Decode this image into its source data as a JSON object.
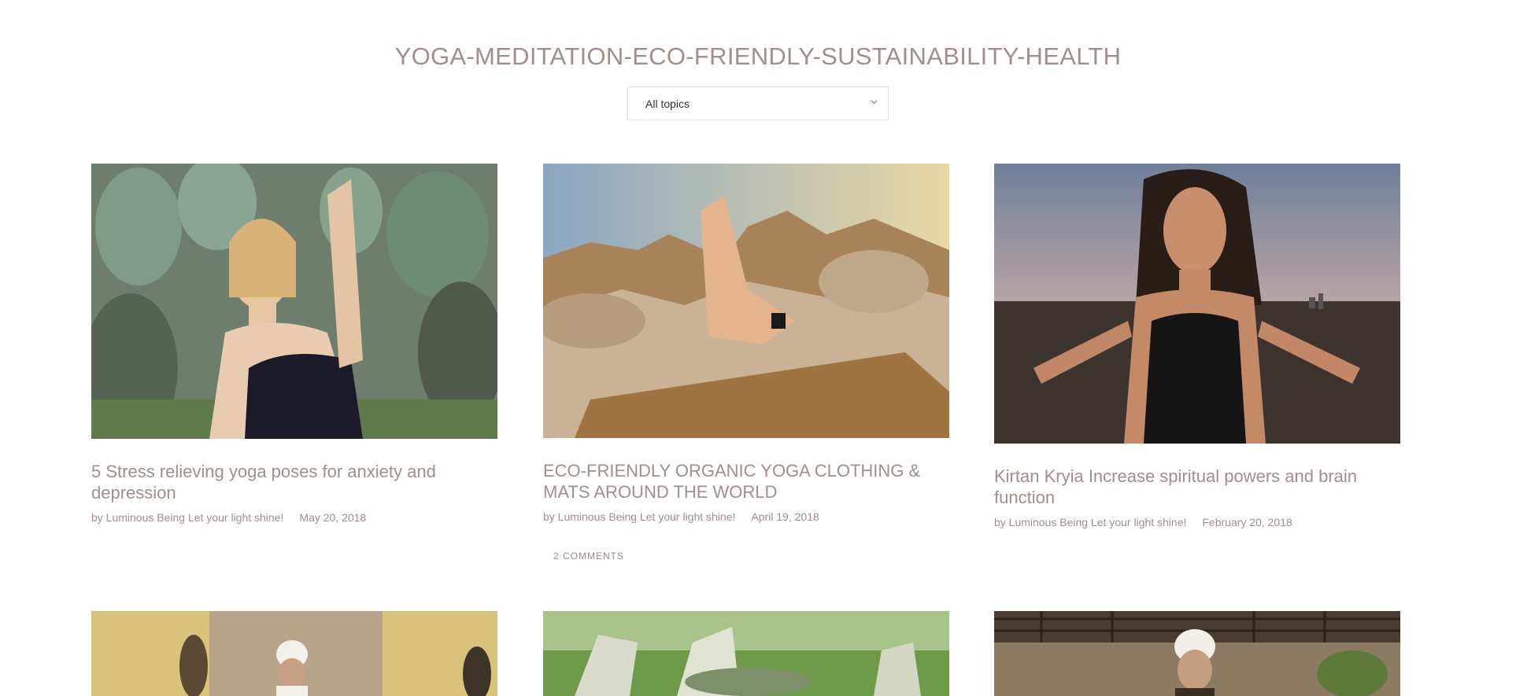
{
  "blog": {
    "title": "YOGA-MEDITATION-ECO-FRIENDLY-SUSTAINABILITY-HEALTH"
  },
  "filter": {
    "selected": "All topics",
    "icon": "chevron-down-icon"
  },
  "colors": {
    "text": "#a08f8b",
    "border": "#e3e3e3",
    "background": "#ffffff"
  },
  "posts": [
    {
      "title": "5 Stress relieving yoga poses for anxiety and depression",
      "author": "by Luminous Being Let your light shine!",
      "date": "May 20, 2018"
    },
    {
      "title": "ECO-FRIENDLY ORGANIC YOGA CLOTHING & MATS AROUND THE WORLD",
      "author": "by Luminous Being Let your light shine!",
      "date": "April 19, 2018",
      "comments": "2 COMMENTS"
    },
    {
      "title": "Kirtan Kryia Increase spiritual powers and brain function",
      "author": "by Luminous Being Let your light shine!",
      "date": "February 20, 2018"
    }
  ]
}
